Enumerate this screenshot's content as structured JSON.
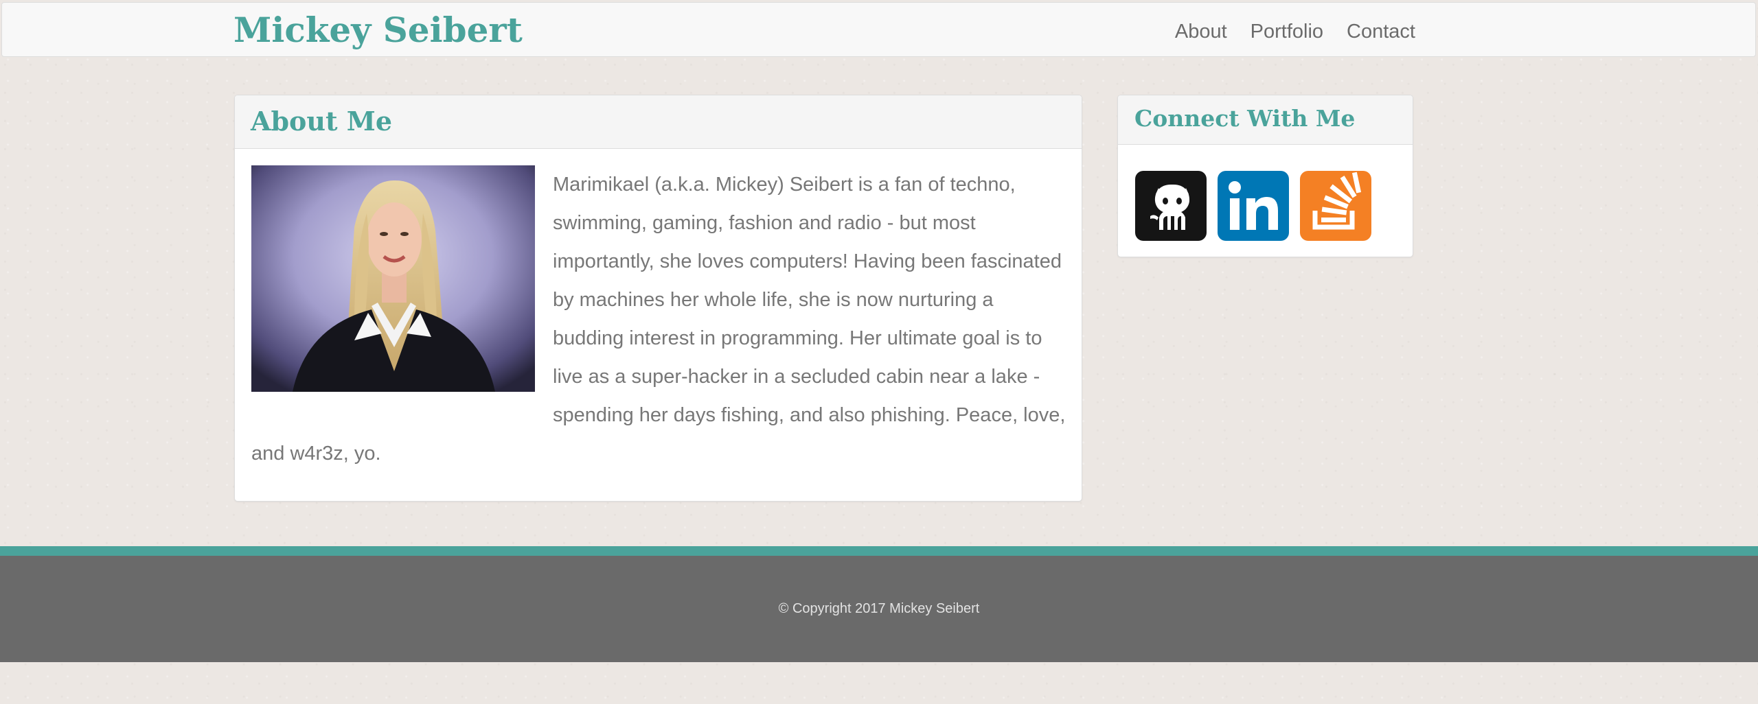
{
  "header": {
    "brand": "Mickey Seibert",
    "nav": [
      {
        "label": "About"
      },
      {
        "label": "Portfolio"
      },
      {
        "label": "Contact"
      }
    ]
  },
  "about": {
    "title": "About Me",
    "bio": "Marimikael (a.k.a. Mickey) Seibert is a fan of techno, swimming, gaming, fashion and radio - but most importantly, she loves computers! Having been fascinated by machines her whole life, she is now nurturing a budding interest in programming. Her ultimate goal is to live as a super-hacker in a secluded cabin near a lake - spending her days fishing, and also phishing. Peace, love, and w4r3z, yo."
  },
  "connect": {
    "title": "Connect With Me",
    "links": [
      {
        "icon": "github-icon",
        "color": "#151515"
      },
      {
        "icon": "linkedin-icon",
        "color": "#0077b5"
      },
      {
        "icon": "stackoverflow-icon",
        "color": "#f48024"
      }
    ]
  },
  "footer": {
    "copyright": "© Copyright 2017 Mickey Seibert"
  },
  "colors": {
    "accent": "#4aa39b",
    "footer_bg": "#6a6a6a",
    "page_bg": "#ece7e3"
  }
}
